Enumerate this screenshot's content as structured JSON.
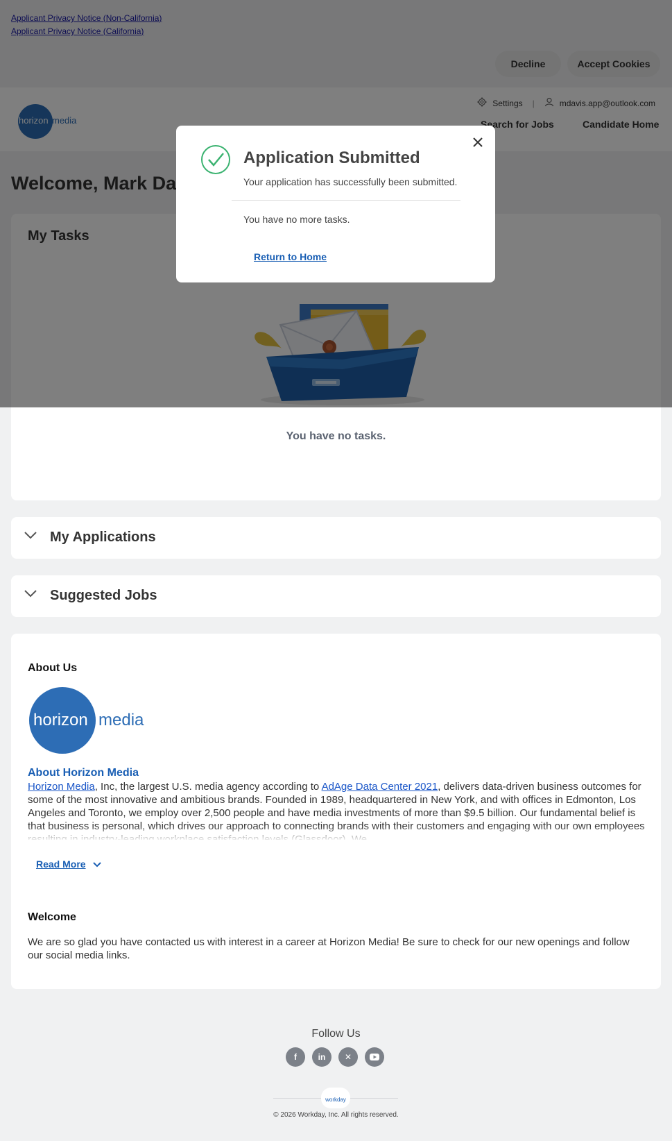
{
  "privacy_links": [
    "Applicant Privacy Notice (Non-California)",
    "Applicant Privacy Notice (California)"
  ],
  "cookie": {
    "decline": "Decline",
    "accept": "Accept Cookies"
  },
  "header": {
    "logo_text_1": "horizon",
    "logo_text_2": "media",
    "settings": "Settings",
    "user_email": "mdavis.app@outlook.com",
    "nav_search": "Search for Jobs",
    "nav_home": "Candidate Home"
  },
  "welcome_title": "Welcome, Mark Davis",
  "tasks": {
    "title": "My Tasks",
    "empty": "You have no tasks."
  },
  "accordions": {
    "applications": "My Applications",
    "suggested": "Suggested Jobs"
  },
  "about": {
    "title": "About Us",
    "logo_text_1": "horizon",
    "logo_text_2": "media",
    "subtitle": "About Horizon Media",
    "link1": "Horizon Media",
    "text1": ", Inc, the largest U.S. media agency according to ",
    "link2": "AdAge Data Center 2021",
    "text2": ", delivers data-driven business outcomes for some of the most innovative and ambitious brands.  Founded in 1989, headquartered in New York, and with offices in Edmonton, Los Angeles and Toronto, we employ over 2,500 people and have media investments of more than $9.5 billion.  Our fundamental belief is that business is personal, which drives our approach to connecting brands with their customers and engaging with our own employees resulting in industry-leading workplace satisfaction levels (Glassdoor).  We",
    "read_more": "Read More"
  },
  "welcome_section": {
    "title": "Welcome",
    "body": "We are so glad you have contacted us with interest in a career at Horizon Media!  Be sure to check for our new openings and follow our social media links."
  },
  "footer": {
    "follow_us": "Follow Us",
    "socials": [
      "facebook-icon",
      "linkedin-icon",
      "x-icon",
      "youtube-icon"
    ],
    "workday": "workday",
    "copyright": "© 2026 Workday, Inc. All rights reserved."
  },
  "modal": {
    "title": "Application Submitted",
    "message": "Your application has successfully been submitted.",
    "tasks": "You have no more tasks.",
    "return_link": "Return to Home"
  },
  "colors": {
    "brand": "#2d6db5",
    "link": "#1a5fb4",
    "success": "#3cb371"
  }
}
